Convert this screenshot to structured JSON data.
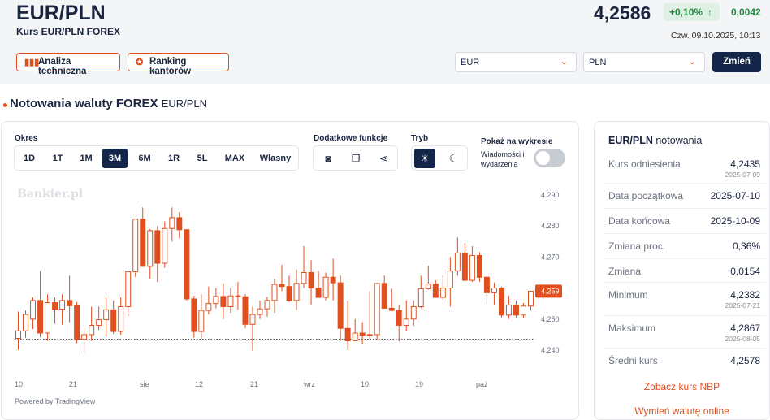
{
  "header": {
    "title": "EUR/PLN",
    "subtitle": "Kurs EUR/PLN FOREX",
    "price": "4,2586",
    "change_pct": "+0,10%",
    "change_abs": "0,0042",
    "timestamp": "Czw. 09.10.2025, 10:13",
    "positive_color": "#1f8a3e"
  },
  "actions": {
    "tech_analysis": "Analiza techniczna",
    "ranking": "Ranking kantorów",
    "from_currency": "EUR",
    "to_currency": "PLN",
    "exchange_button": "Zmień"
  },
  "section": {
    "title": "Notowania waluty FOREX",
    "pair": "EUR/PLN"
  },
  "controls": {
    "period_label": "Okres",
    "periods": [
      "1D",
      "1T",
      "1M",
      "3M",
      "6M",
      "1R",
      "5L",
      "MAX",
      "Własny"
    ],
    "active_period": "3M",
    "extra_label": "Dodatkowe funkcje",
    "mode_label": "Tryb",
    "show_label": "Pokaż na wykresie",
    "news_label": "Wiadomości i wydarzenia"
  },
  "chart": {
    "watermark": "Bankier.pl",
    "powered_by": "Powered by TradingView"
  },
  "chart_data": {
    "type": "candlestick",
    "x_tick_labels": [
      "10",
      "21",
      "sie",
      "12",
      "21",
      "wrz",
      "10",
      "19",
      "paź"
    ],
    "y_tick_labels": [
      "4.290",
      "4.280",
      "4.270",
      "4.260",
      "4.250",
      "4.240"
    ],
    "ylim": [
      4.2365,
      4.2915
    ],
    "last_price_label": "4.259",
    "reference_line": 4.2435,
    "up_color": "#e04f1f",
    "down_color": "#e04f1f",
    "grid": false,
    "series": [
      {
        "name": "",
        "candles": [
          [
            4.2438,
            4.2525,
            4.24,
            4.2462
          ],
          [
            4.2462,
            4.2528,
            4.244,
            4.2515
          ],
          [
            4.25,
            4.257,
            4.2468,
            4.256
          ],
          [
            4.256,
            4.2655,
            4.2442,
            4.2455
          ],
          [
            4.2455,
            4.258,
            4.243,
            4.2553
          ],
          [
            4.2553,
            4.257,
            4.2485,
            4.2532
          ],
          [
            4.2532,
            4.258,
            4.2482,
            4.256
          ],
          [
            4.256,
            4.264,
            4.249,
            4.2543
          ],
          [
            4.2543,
            4.2555,
            4.2422,
            4.2435
          ],
          [
            4.2435,
            4.247,
            4.2392,
            4.245
          ],
          [
            4.245,
            4.254,
            4.243,
            4.248
          ],
          [
            4.248,
            4.254,
            4.2465,
            4.2498
          ],
          [
            4.2498,
            4.257,
            4.2445,
            4.253
          ],
          [
            4.253,
            4.256,
            4.2453,
            4.246
          ],
          [
            4.246,
            4.257,
            4.245,
            4.254
          ],
          [
            4.254,
            4.263,
            4.251,
            4.2653
          ],
          [
            4.2653,
            4.281,
            4.2635,
            4.2822
          ],
          [
            4.2822,
            4.286,
            4.27,
            4.267
          ],
          [
            4.267,
            4.279,
            4.263,
            4.2785
          ],
          [
            4.2785,
            4.28,
            4.262,
            4.268
          ],
          [
            4.268,
            4.2815,
            4.2665,
            4.2792
          ],
          [
            4.2792,
            4.286,
            4.275,
            4.2827
          ],
          [
            4.2827,
            4.2845,
            4.276,
            4.2788
          ],
          [
            4.2788,
            4.279,
            4.256,
            4.2565
          ],
          [
            4.2565,
            4.2575,
            4.244,
            4.246
          ],
          [
            4.246,
            4.258,
            4.2438,
            4.2528
          ],
          [
            4.2528,
            4.2605,
            4.2515,
            4.255
          ],
          [
            4.255,
            4.26,
            4.2535,
            4.2573
          ],
          [
            4.2573,
            4.2615,
            4.25,
            4.254
          ],
          [
            4.254,
            4.26,
            4.252,
            4.2575
          ],
          [
            4.2575,
            4.262,
            4.253,
            4.2572
          ],
          [
            4.2572,
            4.258,
            4.247,
            4.2483
          ],
          [
            4.2483,
            4.254,
            4.2398,
            4.2515
          ],
          [
            4.2515,
            4.256,
            4.25,
            4.2533
          ],
          [
            4.2533,
            4.2572,
            4.2508,
            4.256
          ],
          [
            4.256,
            4.263,
            4.252,
            4.2612
          ],
          [
            4.2612,
            4.2675,
            4.259,
            4.2605
          ],
          [
            4.2605,
            4.264,
            4.2555,
            4.256
          ],
          [
            4.256,
            4.266,
            4.253,
            4.2615
          ],
          [
            4.2615,
            4.2735,
            4.26,
            4.265
          ],
          [
            4.265,
            4.269,
            4.2545,
            4.26
          ],
          [
            4.26,
            4.2655,
            4.257,
            4.257
          ],
          [
            4.257,
            4.265,
            4.256,
            4.2635
          ],
          [
            4.2635,
            4.2695,
            4.256,
            4.2617
          ],
          [
            4.2617,
            4.264,
            4.243,
            4.247
          ],
          [
            4.247,
            4.256,
            4.24,
            4.243
          ],
          [
            4.243,
            4.25,
            4.244,
            4.2455
          ],
          [
            4.2455,
            4.249,
            4.242,
            4.2448
          ],
          [
            4.2448,
            4.259,
            4.2434,
            4.245
          ],
          [
            4.245,
            4.2605,
            4.2435,
            4.2615
          ],
          [
            4.2615,
            4.264,
            4.2545,
            4.2535
          ],
          [
            4.2535,
            4.2598,
            4.2525,
            4.2528
          ],
          [
            4.2528,
            4.2545,
            4.2428,
            4.248
          ],
          [
            4.248,
            4.256,
            4.246,
            4.25
          ],
          [
            4.25,
            4.256,
            4.2478,
            4.254
          ],
          [
            4.254,
            4.264,
            4.2535,
            4.2598
          ],
          [
            4.2598,
            4.2672,
            4.2595,
            4.2613
          ],
          [
            4.2613,
            4.2625,
            4.259,
            4.257
          ],
          [
            4.257,
            4.264,
            4.256,
            4.26
          ],
          [
            4.26,
            4.27,
            4.254,
            4.2655
          ],
          [
            4.2655,
            4.2763,
            4.264,
            4.2713
          ],
          [
            4.2713,
            4.2745,
            4.263,
            4.2625
          ],
          [
            4.2625,
            4.2735,
            4.262,
            4.2705
          ],
          [
            4.2705,
            4.2715,
            4.262,
            4.2635
          ],
          [
            4.2635,
            4.264,
            4.2545,
            4.2585
          ],
          [
            4.2585,
            4.2618,
            4.2545,
            4.26
          ],
          [
            4.26,
            4.2605,
            4.2505,
            4.2513
          ],
          [
            4.2513,
            4.2575,
            4.25,
            4.2545
          ],
          [
            4.2545,
            4.256,
            4.2505,
            4.2513
          ],
          [
            4.2513,
            4.2552,
            4.2502,
            4.2542
          ],
          [
            4.2542,
            4.259,
            4.2528,
            4.259
          ]
        ]
      }
    ]
  },
  "side": {
    "title_bold": "EUR/PLN",
    "title_rest": "notowania",
    "rows": [
      {
        "label": "Kurs odniesienia",
        "value": "4,2435",
        "date": "2025-07-09"
      },
      {
        "label": "Data początkowa",
        "value": "2025-07-10",
        "date": ""
      },
      {
        "label": "Data końcowa",
        "value": "2025-10-09",
        "date": ""
      },
      {
        "label": "Zmiana proc.",
        "value": "0,36%",
        "date": ""
      },
      {
        "label": "Zmiana",
        "value": "0,0154",
        "date": ""
      },
      {
        "label": "Minimum",
        "value": "4,2382",
        "date": "2025-07-21"
      },
      {
        "label": "Maksimum",
        "value": "4,2867",
        "date": "2025-08-05"
      },
      {
        "label": "Średni kurs",
        "value": "4,2578",
        "date": ""
      }
    ],
    "link_nbp": "Zobacz kurs NBP",
    "link_exchange": "Wymień walutę online"
  }
}
